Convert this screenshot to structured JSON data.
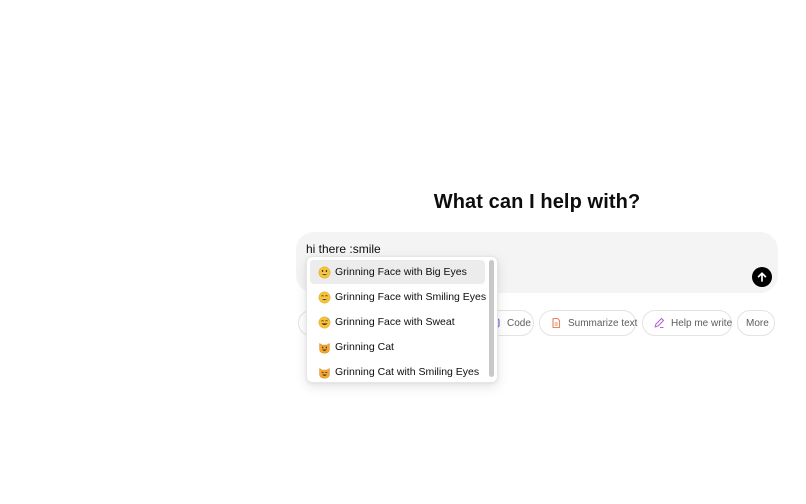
{
  "heading": "What can I help with?",
  "composer": {
    "input_value": "hi there :smile",
    "send_label": "Send"
  },
  "emoji_suggestions": [
    {
      "label": "Grinning Face with Big Eyes",
      "icon": "grinning-face-big-eyes-icon",
      "active": true
    },
    {
      "label": "Grinning Face with Smiling Eyes",
      "icon": "grinning-face-smiling-eyes-icon",
      "active": false
    },
    {
      "label": "Grinning Face with Sweat",
      "icon": "grinning-face-sweat-icon",
      "active": false
    },
    {
      "label": "Grinning Cat",
      "icon": "grinning-cat-icon",
      "active": false
    },
    {
      "label": "Grinning Cat with Smiling Eyes",
      "icon": "grinning-cat-smiling-eyes-icon",
      "active": false
    }
  ],
  "quick_actions": [
    {
      "label": "Code",
      "icon": "code-icon"
    },
    {
      "label": "Summarize text",
      "icon": "document-icon"
    },
    {
      "label": "Help me write",
      "icon": "pen-icon"
    },
    {
      "label": "More",
      "icon": ""
    }
  ],
  "colors": {
    "composer_bg": "#f4f4f4",
    "send_button": "#000000",
    "active_item_bg": "#ececec",
    "chip_border": "#e3e3e3",
    "summarize_icon": "#e8875c",
    "write_icon": "#b565d8",
    "code_icon": "#7a6ae0"
  }
}
